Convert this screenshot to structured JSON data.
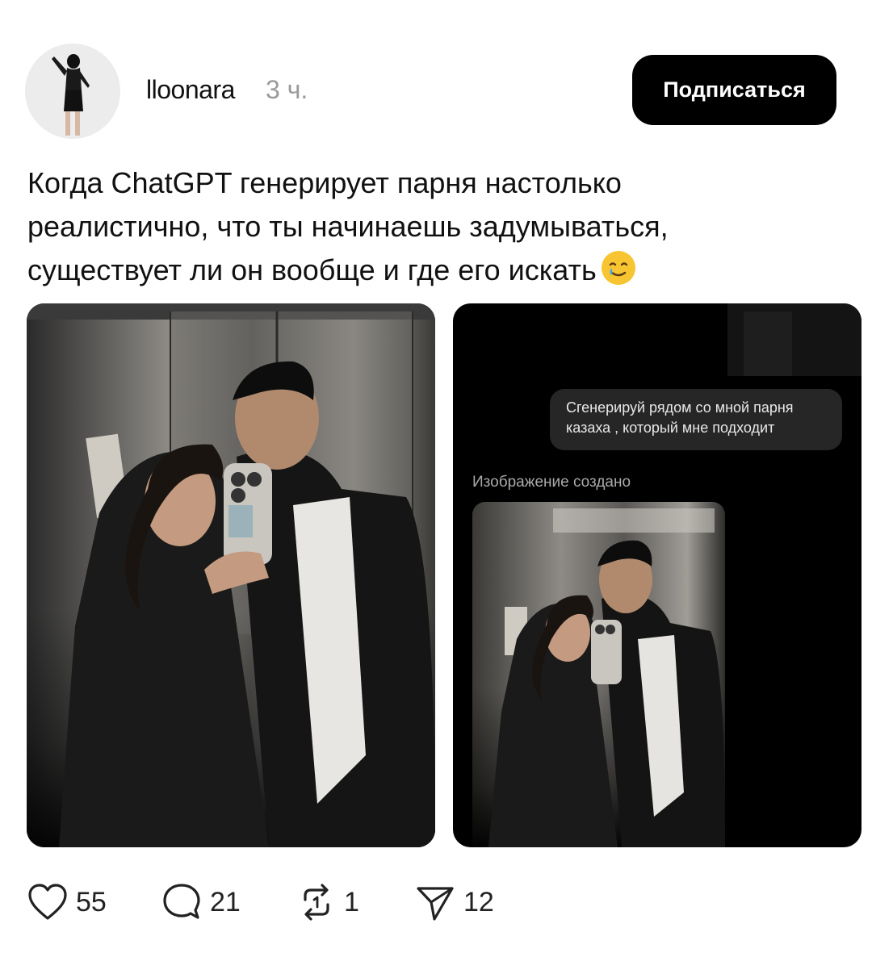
{
  "post": {
    "author": "lloonara",
    "time": "3 ч.",
    "follow_label": "Подписаться",
    "text_lines": [
      "Когда ChatGPT генерирует парня настолько",
      "реалистично, что ты начинаешь задумываться,",
      "существует ли он вообще и где его искать"
    ],
    "emoji": "smiling-face-with-tear"
  },
  "screenshot_card": {
    "prompt_bubble_lines": [
      "Сгенерируй рядом со мной парня",
      "казаха  , который мне подходит"
    ],
    "generated_label": "Изображение создано"
  },
  "actions": {
    "likes": "55",
    "comments": "21",
    "reposts": "1",
    "shares": "12"
  },
  "colors": {
    "button_bg": "#000000",
    "timestamp": "#9a9a9a",
    "bubble_bg": "#262626"
  }
}
